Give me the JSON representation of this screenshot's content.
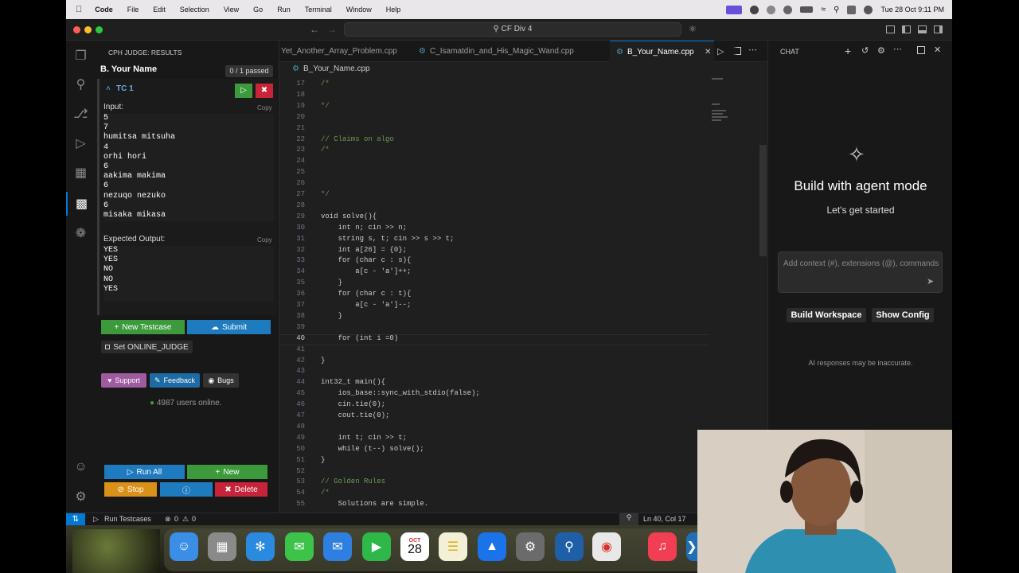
{
  "menubar": {
    "apple": "",
    "app": "Code",
    "items": [
      "File",
      "Edit",
      "Selection",
      "View",
      "Go",
      "Run",
      "Terminal",
      "Window",
      "Help"
    ],
    "datetime": "Tue 28 Oct  9:11 PM"
  },
  "window": {
    "command_center": "CF Div 4"
  },
  "cph": {
    "header": "CPH JUDGE: RESULTS",
    "problem_title": "B. Your Name",
    "passed_badge": "0 / 1 passed",
    "testcase_label": "TC 1",
    "input_label": "Input:",
    "copy_label": "Copy",
    "input_lines": [
      "5",
      "7",
      "humitsa mitsuha",
      "4",
      "orhi hori",
      "6",
      "aakima makima",
      "6",
      "nezuqo nezuko",
      "6",
      "misaka mikasa"
    ],
    "expected_label": "Expected Output:",
    "expected_lines": [
      "YES",
      "YES",
      "NO",
      "NO",
      "YES"
    ],
    "new_testcase": "New Testcase",
    "submit": "Submit",
    "set_online_judge": "Set ONLINE_JUDGE",
    "support": "Support",
    "feedback": "Feedback",
    "bugs": "Bugs",
    "users_online": "4987 users online.",
    "run_all": "Run All",
    "new": "New",
    "stop": "Stop",
    "delete": "Delete"
  },
  "tabs": [
    {
      "label": "Yet_Another_Array_Problem.cpp",
      "active": false
    },
    {
      "label": "C_Isamatdin_and_His_Magic_Wand.cpp",
      "active": false
    },
    {
      "label": "B_Your_Name.cpp",
      "active": true
    }
  ],
  "breadcrumb": "B_Your_Name.cpp",
  "code_lines": [
    {
      "n": "17",
      "t": "/*"
    },
    {
      "n": "18",
      "t": ""
    },
    {
      "n": "19",
      "t": "*/"
    },
    {
      "n": "20",
      "t": ""
    },
    {
      "n": "21",
      "t": ""
    },
    {
      "n": "22",
      "t": "// Claims on algo"
    },
    {
      "n": "23",
      "t": "/*"
    },
    {
      "n": "24",
      "t": ""
    },
    {
      "n": "25",
      "t": ""
    },
    {
      "n": "26",
      "t": ""
    },
    {
      "n": "27",
      "t": "*/"
    },
    {
      "n": "28",
      "t": ""
    },
    {
      "n": "29",
      "t": "void solve(){"
    },
    {
      "n": "30",
      "t": "    int n; cin >> n;"
    },
    {
      "n": "31",
      "t": "    string s, t; cin >> s >> t;"
    },
    {
      "n": "32",
      "t": "    int a[26] = {0};"
    },
    {
      "n": "33",
      "t": "    for (char c : s){"
    },
    {
      "n": "34",
      "t": "        a[c - 'a']++;"
    },
    {
      "n": "35",
      "t": "    }"
    },
    {
      "n": "36",
      "t": "    for (char c : t){"
    },
    {
      "n": "37",
      "t": "        a[c - 'a']--;"
    },
    {
      "n": "38",
      "t": "    }"
    },
    {
      "n": "39",
      "t": ""
    },
    {
      "n": "40",
      "t": "    for (int i =0)"
    },
    {
      "n": "41",
      "t": ""
    },
    {
      "n": "42",
      "t": "}"
    },
    {
      "n": "43",
      "t": ""
    },
    {
      "n": "44",
      "t": "int32_t main(){"
    },
    {
      "n": "45",
      "t": "    ios_base::sync_with_stdio(false);"
    },
    {
      "n": "46",
      "t": "    cin.tie(0);"
    },
    {
      "n": "47",
      "t": "    cout.tie(0);"
    },
    {
      "n": "48",
      "t": ""
    },
    {
      "n": "49",
      "t": "    int t; cin >> t;"
    },
    {
      "n": "50",
      "t": "    while (t--) solve();"
    },
    {
      "n": "51",
      "t": "}"
    },
    {
      "n": "52",
      "t": ""
    },
    {
      "n": "53",
      "t": "// Golden Rules"
    },
    {
      "n": "54",
      "t": "/*"
    },
    {
      "n": "55",
      "t": "    Solutions are simple."
    }
  ],
  "chat": {
    "header": "CHAT",
    "title": "Build with agent mode",
    "subtitle": "Let's get started",
    "input_placeholder": "Add context (#), extensions (@), commands",
    "build_workspace": "Build Workspace",
    "show_config": "Show Config",
    "disclaimer": "AI responses may be inaccurate."
  },
  "status": {
    "run_testcases": "Run Testcases",
    "problems": "0",
    "warnings": "0",
    "cursor": "Ln 40, Col 17"
  },
  "dock": {
    "calendar_month": "OCT",
    "calendar_day": "28"
  },
  "colors": {
    "green_btn": "#3c9a3c",
    "blue_btn": "#1e7bbf",
    "orange_btn": "#d9911a",
    "red_btn": "#c7243a",
    "keyword": "#569cd6",
    "comment": "#6a9955"
  }
}
